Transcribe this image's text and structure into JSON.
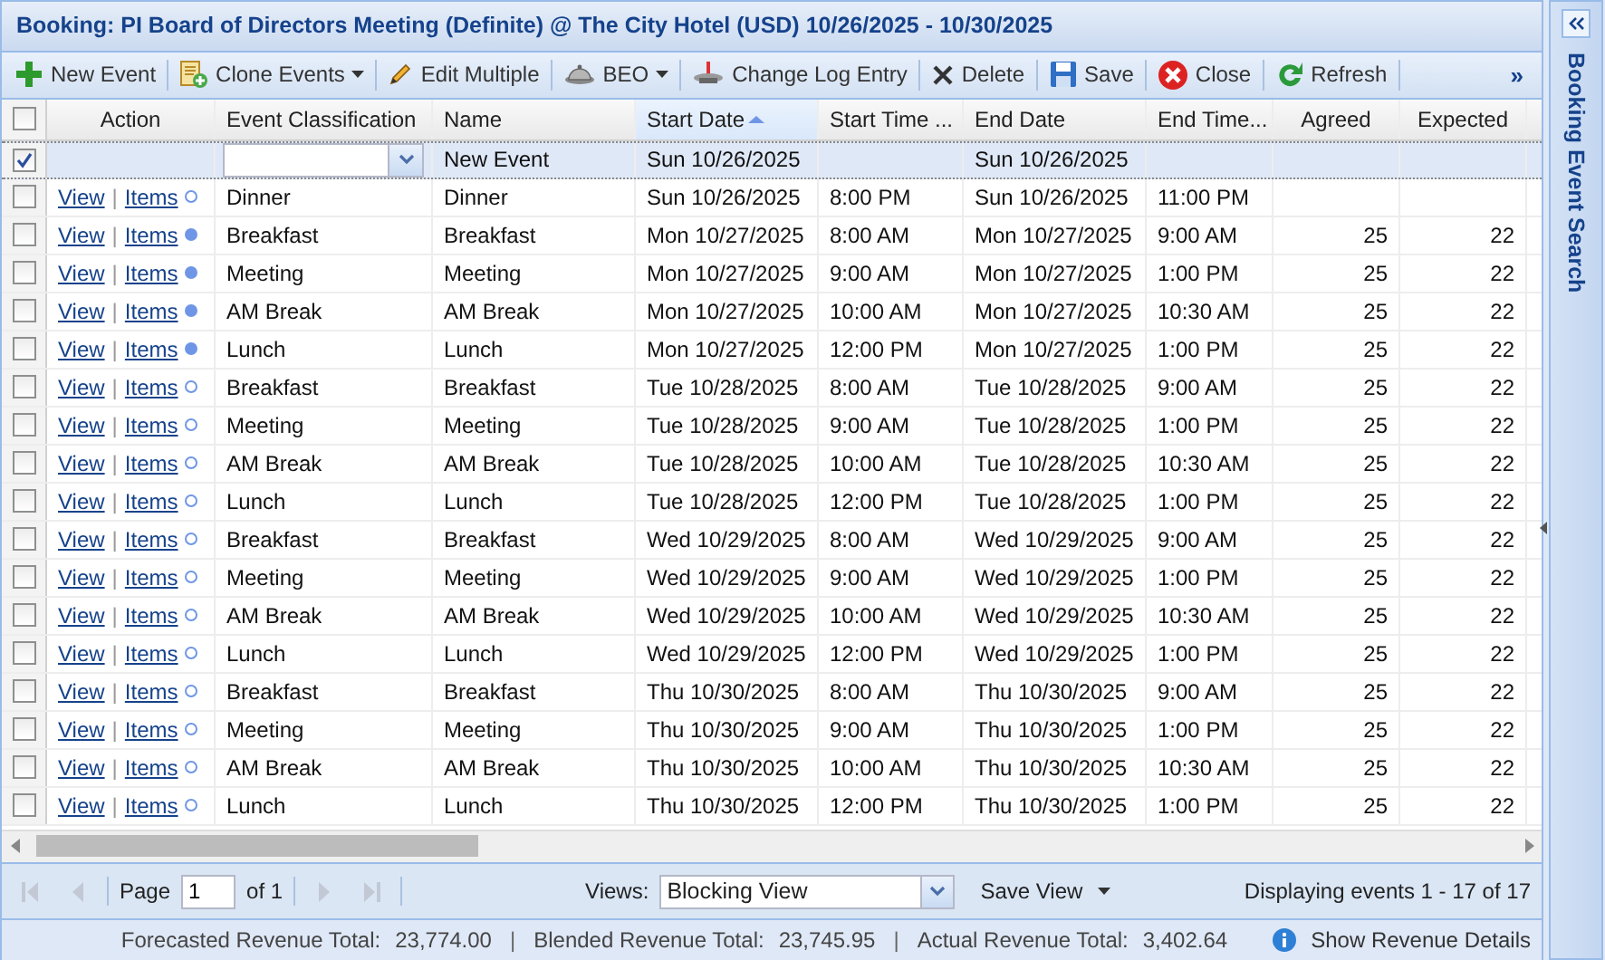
{
  "window": {
    "title": "Booking: PI Board of Directors Meeting (Definite) @ The City Hotel (USD) 10/26/2025 - 10/30/2025"
  },
  "toolbar": {
    "items": [
      {
        "kind": "plus",
        "label": "New Event"
      },
      {
        "kind": "clone",
        "label": "Clone Events",
        "has_menu": true
      },
      {
        "kind": "pencil",
        "label": "Edit Multiple"
      },
      {
        "kind": "bell",
        "label": "BEO",
        "has_menu": true
      },
      {
        "kind": "log",
        "label": "Change Log Entry"
      },
      {
        "kind": "delete",
        "label": "Delete"
      },
      {
        "kind": "save",
        "label": "Save"
      },
      {
        "kind": "close",
        "label": "Close"
      },
      {
        "kind": "refresh",
        "label": "Refresh"
      }
    ],
    "overflow": "»"
  },
  "table": {
    "select_all": false,
    "columns": [
      {
        "label": "Action",
        "sorted": false
      },
      {
        "label": "Event Classification",
        "sorted": false
      },
      {
        "label": "Name",
        "sorted": false
      },
      {
        "label": "Start Date",
        "sorted": true
      },
      {
        "label": "Start Time ...",
        "sorted": false
      },
      {
        "label": "End Date",
        "sorted": false
      },
      {
        "label": "End Time...",
        "sorted": false
      },
      {
        "label": "Agreed",
        "sorted": false
      },
      {
        "label": "Expected",
        "sorted": false
      }
    ],
    "new_row": {
      "checked": true,
      "name": "New Event",
      "start_date": "Sun 10/26/2025",
      "end_date": "Sun 10/26/2025"
    },
    "rows": [
      {
        "checked": false,
        "view": "View",
        "separator": "|",
        "items": "Items",
        "has_items": false,
        "classification": "Dinner",
        "name": "Dinner",
        "start_date": "Sun 10/26/2025",
        "start_time": "8:00 PM",
        "end_date": "Sun 10/26/2025",
        "end_time": "11:00 PM"
      },
      {
        "checked": false,
        "view": "View",
        "separator": "|",
        "items": "Items",
        "has_items": true,
        "classification": "Breakfast",
        "name": "Breakfast",
        "start_date": "Mon 10/27/2025",
        "start_time": "8:00 AM",
        "end_date": "Mon 10/27/2025",
        "end_time": "9:00 AM",
        "agreed": "25",
        "expected": "22"
      },
      {
        "checked": false,
        "view": "View",
        "separator": "|",
        "items": "Items",
        "has_items": true,
        "classification": "Meeting",
        "name": "Meeting",
        "start_date": "Mon 10/27/2025",
        "start_time": "9:00 AM",
        "end_date": "Mon 10/27/2025",
        "end_time": "1:00 PM",
        "agreed": "25",
        "expected": "22"
      },
      {
        "checked": false,
        "view": "View",
        "separator": "|",
        "items": "Items",
        "has_items": true,
        "classification": "AM Break",
        "name": "AM Break",
        "start_date": "Mon 10/27/2025",
        "start_time": "10:00 AM",
        "end_date": "Mon 10/27/2025",
        "end_time": "10:30 AM",
        "agreed": "25",
        "expected": "22"
      },
      {
        "checked": false,
        "view": "View",
        "separator": "|",
        "items": "Items",
        "has_items": true,
        "classification": "Lunch",
        "name": "Lunch",
        "start_date": "Mon 10/27/2025",
        "start_time": "12:00 PM",
        "end_date": "Mon 10/27/2025",
        "end_time": "1:00 PM",
        "agreed": "25",
        "expected": "22"
      },
      {
        "checked": false,
        "view": "View",
        "separator": "|",
        "items": "Items",
        "has_items": false,
        "classification": "Breakfast",
        "name": "Breakfast",
        "start_date": "Tue 10/28/2025",
        "start_time": "8:00 AM",
        "end_date": "Tue 10/28/2025",
        "end_time": "9:00 AM",
        "agreed": "25",
        "expected": "22"
      },
      {
        "checked": false,
        "view": "View",
        "separator": "|",
        "items": "Items",
        "has_items": false,
        "classification": "Meeting",
        "name": "Meeting",
        "start_date": "Tue 10/28/2025",
        "start_time": "9:00 AM",
        "end_date": "Tue 10/28/2025",
        "end_time": "1:00 PM",
        "agreed": "25",
        "expected": "22"
      },
      {
        "checked": false,
        "view": "View",
        "separator": "|",
        "items": "Items",
        "has_items": false,
        "classification": "AM Break",
        "name": "AM Break",
        "start_date": "Tue 10/28/2025",
        "start_time": "10:00 AM",
        "end_date": "Tue 10/28/2025",
        "end_time": "10:30 AM",
        "agreed": "25",
        "expected": "22"
      },
      {
        "checked": false,
        "view": "View",
        "separator": "|",
        "items": "Items",
        "has_items": false,
        "classification": "Lunch",
        "name": "Lunch",
        "start_date": "Tue 10/28/2025",
        "start_time": "12:00 PM",
        "end_date": "Tue 10/28/2025",
        "end_time": "1:00 PM",
        "agreed": "25",
        "expected": "22"
      },
      {
        "checked": false,
        "view": "View",
        "separator": "|",
        "items": "Items",
        "has_items": false,
        "classification": "Breakfast",
        "name": "Breakfast",
        "start_date": "Wed 10/29/2025",
        "start_time": "8:00 AM",
        "end_date": "Wed 10/29/2025",
        "end_time": "9:00 AM",
        "agreed": "25",
        "expected": "22"
      },
      {
        "checked": false,
        "view": "View",
        "separator": "|",
        "items": "Items",
        "has_items": false,
        "classification": "Meeting",
        "name": "Meeting",
        "start_date": "Wed 10/29/2025",
        "start_time": "9:00 AM",
        "end_date": "Wed 10/29/2025",
        "end_time": "1:00 PM",
        "agreed": "25",
        "expected": "22"
      },
      {
        "checked": false,
        "view": "View",
        "separator": "|",
        "items": "Items",
        "has_items": false,
        "classification": "AM Break",
        "name": "AM Break",
        "start_date": "Wed 10/29/2025",
        "start_time": "10:00 AM",
        "end_date": "Wed 10/29/2025",
        "end_time": "10:30 AM",
        "agreed": "25",
        "expected": "22"
      },
      {
        "checked": false,
        "view": "View",
        "separator": "|",
        "items": "Items",
        "has_items": false,
        "classification": "Lunch",
        "name": "Lunch",
        "start_date": "Wed 10/29/2025",
        "start_time": "12:00 PM",
        "end_date": "Wed 10/29/2025",
        "end_time": "1:00 PM",
        "agreed": "25",
        "expected": "22"
      },
      {
        "checked": false,
        "view": "View",
        "separator": "|",
        "items": "Items",
        "has_items": false,
        "classification": "Breakfast",
        "name": "Breakfast",
        "start_date": "Thu 10/30/2025",
        "start_time": "8:00 AM",
        "end_date": "Thu 10/30/2025",
        "end_time": "9:00 AM",
        "agreed": "25",
        "expected": "22"
      },
      {
        "checked": false,
        "view": "View",
        "separator": "|",
        "items": "Items",
        "has_items": false,
        "classification": "Meeting",
        "name": "Meeting",
        "start_date": "Thu 10/30/2025",
        "start_time": "9:00 AM",
        "end_date": "Thu 10/30/2025",
        "end_time": "1:00 PM",
        "agreed": "25",
        "expected": "22"
      },
      {
        "checked": false,
        "view": "View",
        "separator": "|",
        "items": "Items",
        "has_items": false,
        "classification": "AM Break",
        "name": "AM Break",
        "start_date": "Thu 10/30/2025",
        "start_time": "10:00 AM",
        "end_date": "Thu 10/30/2025",
        "end_time": "10:30 AM",
        "agreed": "25",
        "expected": "22"
      },
      {
        "checked": false,
        "view": "View",
        "separator": "|",
        "items": "Items",
        "has_items": false,
        "classification": "Lunch",
        "name": "Lunch",
        "start_date": "Thu 10/30/2025",
        "start_time": "12:00 PM",
        "end_date": "Thu 10/30/2025",
        "end_time": "1:00 PM",
        "agreed": "25",
        "expected": "22"
      }
    ]
  },
  "pager": {
    "page_label": "Page",
    "page": "1",
    "of_label": "of 1",
    "views_label": "Views:",
    "view": "Blocking View",
    "save_view": "Save View",
    "displaying": "Displaying events 1 - 17 of 17"
  },
  "revenue": {
    "items": [
      {
        "label": "Forecasted Revenue Total:",
        "value": "23,774.00"
      },
      {
        "separator": "|",
        "label": "Blended Revenue Total:",
        "value": "23,745.95"
      },
      {
        "separator": "|",
        "label": "Actual Revenue Total:",
        "value": "3,402.64"
      }
    ],
    "details_link": "Show Revenue Details"
  },
  "side_panel": {
    "title": "Booking Event Search"
  }
}
